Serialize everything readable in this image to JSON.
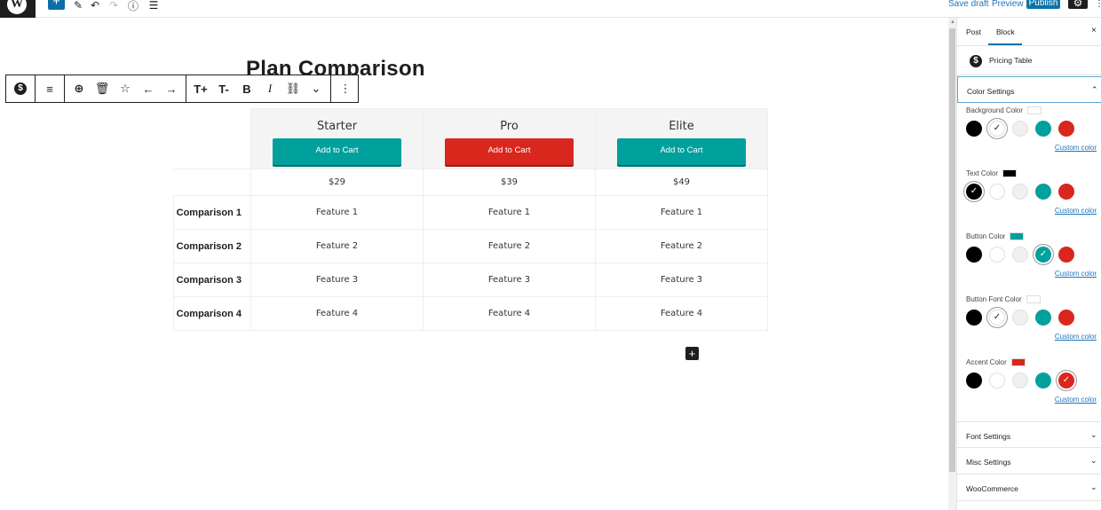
{
  "topbar": {
    "logo": "W",
    "add_icon": "+",
    "pen_icon": "✎",
    "undo_icon": "↶",
    "redo_icon": "↷",
    "info_icon": "ⓘ",
    "list_icon": "☰",
    "save_draft": "Save draft",
    "preview": "Preview",
    "publish": "Publish",
    "settings_icon": "⚙",
    "more_icon": "⋮"
  },
  "editor": {
    "title": "Plan Comparison",
    "toolbar": {
      "block_icon": "$",
      "align_icon": "≡",
      "add_icon": "⊕",
      "delete_icon": "🗑",
      "star_icon": "☆",
      "left_icon": "←",
      "right_icon": "→",
      "text_increase": "T+",
      "text_decrease": "T-",
      "bold": "B",
      "italic": "I",
      "link_icon": "⛓",
      "more_icon": "⌄",
      "options_icon": "⋮"
    },
    "plans": [
      {
        "name": "Starter",
        "button": "Add to Cart",
        "price": "$29",
        "button_color": "#00a09d"
      },
      {
        "name": "Pro",
        "button": "Add to Cart",
        "price": "$39",
        "button_color": "#d9271d"
      },
      {
        "name": "Elite",
        "button": "Add to Cart",
        "price": "$49",
        "button_color": "#00a09d"
      }
    ],
    "rows": [
      {
        "label": "Comparison 1",
        "features": [
          "Feature 1",
          "Feature 1",
          "Feature 1"
        ]
      },
      {
        "label": "Comparison 2",
        "features": [
          "Feature 2",
          "Feature 2",
          "Feature 2"
        ]
      },
      {
        "label": "Comparison 3",
        "features": [
          "Feature 3",
          "Feature 3",
          "Feature 3"
        ]
      },
      {
        "label": "Comparison 4",
        "features": [
          "Feature 4",
          "Feature 4",
          "Feature 4"
        ]
      }
    ],
    "add_block_icon": "+"
  },
  "sidebar": {
    "tabs": [
      "Post",
      "Block"
    ],
    "active_tab": "Block",
    "close_icon": "×",
    "block_name": "Pricing Table",
    "block_icon": "$",
    "color_panel": {
      "label": "Color Settings",
      "chevron": "⌃"
    },
    "palette": [
      "#000000",
      "#ffffff",
      "#f0f0f0",
      "#00a09d",
      "#d9271d"
    ],
    "color_sections": [
      {
        "label": "Background Color",
        "swatch": "#ffffff",
        "selected": 1,
        "custom": "Custom color"
      },
      {
        "label": "Text Color",
        "swatch": "#000000",
        "selected": 0,
        "custom": "Custom color"
      },
      {
        "label": "Button Color",
        "swatch": "#00a09d",
        "selected": 3,
        "custom": "Custom color"
      },
      {
        "label": "Button Font Color",
        "swatch": "#ffffff",
        "selected": 1,
        "custom": "Custom color"
      },
      {
        "label": "Accent Color",
        "swatch": "#d9271d",
        "selected": 4,
        "custom": "Custom color"
      }
    ],
    "collapsed_panels": [
      {
        "label": "Font Settings",
        "chevron": "⌄"
      },
      {
        "label": "Misc Settings",
        "chevron": "⌄"
      },
      {
        "label": "WooCommerce",
        "chevron": "⌄"
      }
    ]
  }
}
